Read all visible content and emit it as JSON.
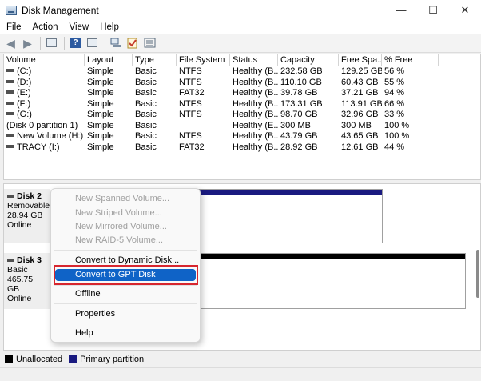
{
  "window": {
    "title": "Disk Management",
    "minimize": "—",
    "maximize": "☐",
    "close": "✕"
  },
  "menu": [
    "File",
    "Action",
    "View",
    "Help"
  ],
  "toolbar": {
    "icons": [
      "back-arrow-icon",
      "forward-arrow-icon",
      "console-tree-icon",
      "help-icon",
      "properties-icon",
      "connect-icon",
      "check-icon",
      "list-icon"
    ]
  },
  "volume_list": {
    "columns": [
      "Volume",
      "Layout",
      "Type",
      "File System",
      "Status",
      "Capacity",
      "Free Spa...",
      "% Free"
    ],
    "rows": [
      [
        "(C:)",
        "Simple",
        "Basic",
        "NTFS",
        "Healthy (B...",
        "232.58 GB",
        "129.25 GB",
        "56 %"
      ],
      [
        "(D:)",
        "Simple",
        "Basic",
        "NTFS",
        "Healthy (B...",
        "110.10 GB",
        "60.43 GB",
        "55 %"
      ],
      [
        "(E:)",
        "Simple",
        "Basic",
        "FAT32",
        "Healthy (B...",
        "39.78 GB",
        "37.21 GB",
        "94 %"
      ],
      [
        "(F:)",
        "Simple",
        "Basic",
        "NTFS",
        "Healthy (B...",
        "173.31 GB",
        "113.91 GB",
        "66 %"
      ],
      [
        "(G:)",
        "Simple",
        "Basic",
        "NTFS",
        "Healthy (B...",
        "98.70 GB",
        "32.96 GB",
        "33 %"
      ],
      [
        "(Disk 0 partition 1)",
        "Simple",
        "Basic",
        "",
        "Healthy (E...",
        "300 MB",
        "300 MB",
        "100 %"
      ],
      [
        "New Volume (H:)",
        "Simple",
        "Basic",
        "NTFS",
        "Healthy (B...",
        "43.79 GB",
        "43.65 GB",
        "100 %"
      ],
      [
        "TRACY (I:)",
        "Simple",
        "Basic",
        "FAT32",
        "Healthy (B...",
        "28.92 GB",
        "12.61 GB",
        "44 %"
      ]
    ],
    "row_icons": [
      true,
      true,
      true,
      true,
      true,
      false,
      true,
      true
    ]
  },
  "disks": [
    {
      "name": "Disk 2",
      "type": "Removable",
      "size": "28.94 GB",
      "status": "Online",
      "bar_color": "#1a1a80"
    },
    {
      "name": "Disk 3",
      "type": "Basic",
      "size": "465.75 GB",
      "status": "Online",
      "bar_color": "#000000"
    }
  ],
  "legend": [
    {
      "label": "Unallocated",
      "color": "#000000"
    },
    {
      "label": "Primary partition",
      "color": "#1a1a80"
    }
  ],
  "context_menu": {
    "items": [
      {
        "label": "New Spanned Volume...",
        "enabled": false
      },
      {
        "label": "New Striped Volume...",
        "enabled": false
      },
      {
        "label": "New Mirrored Volume...",
        "enabled": false
      },
      {
        "label": "New RAID-5 Volume...",
        "enabled": false
      },
      {
        "label": "Convert to Dynamic Disk...",
        "enabled": true
      },
      {
        "label": "Convert to GPT Disk",
        "enabled": true,
        "highlighted": true
      },
      {
        "label": "Offline",
        "enabled": true
      },
      {
        "label": "Properties",
        "enabled": true
      },
      {
        "label": "Help",
        "enabled": true
      }
    ],
    "highlight_color": "#0f63c7",
    "annotation_color": "#d7262f"
  }
}
